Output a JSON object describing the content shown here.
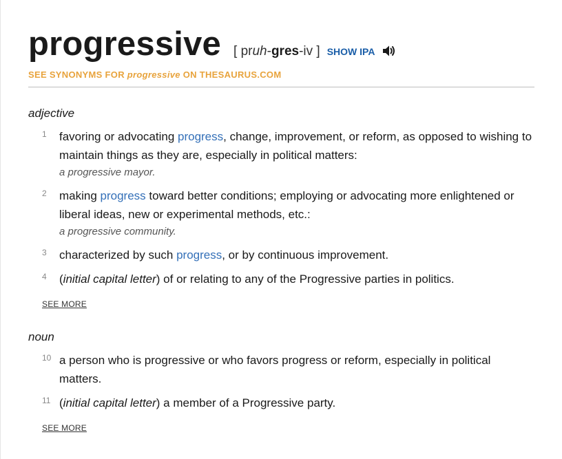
{
  "entry": {
    "headword": "progressive",
    "pron_open": "[ pr",
    "pron_uh": "uh",
    "pron_dash1": "-",
    "pron_gres": "gres",
    "pron_rest": "-iv ]",
    "show_ipa_label": "SHOW IPA",
    "speaker_icon": "speaker-icon"
  },
  "synonyms": {
    "prefix": "SEE SYNONYMS FOR ",
    "word": "progressive",
    "suffix": " ON THESAURUS.COM"
  },
  "sections": {
    "adjective": {
      "pos": "adjective",
      "defs": [
        {
          "num": "1",
          "pre": "favoring or advocating ",
          "link": "progress",
          "post": ", change, improvement, or reform, as opposed to wishing to maintain things as they are, especially in political matters:",
          "example": "a progressive mayor."
        },
        {
          "num": "2",
          "pre": "making ",
          "link": "progress",
          "post": " toward better conditions; employing or advocating more enlightened or liberal ideas, new or experimental methods, etc.:",
          "example": "a progressive community."
        },
        {
          "num": "3",
          "pre": "characterized by such ",
          "link": "progress",
          "post": ", or by continuous improvement."
        },
        {
          "num": "4",
          "open": "(",
          "italic": "initial capital letter",
          "close": ") of or relating to any of the Progressive parties in politics."
        }
      ],
      "see_more": "SEE MORE"
    },
    "noun": {
      "pos": "noun",
      "defs": [
        {
          "num": "10",
          "text": "a person who is progressive or who favors progress or reform, especially in political matters."
        },
        {
          "num": "11",
          "open": "(",
          "italic": "initial capital letter",
          "close": ") a member of a Progressive party."
        }
      ],
      "see_more": "SEE MORE"
    }
  }
}
